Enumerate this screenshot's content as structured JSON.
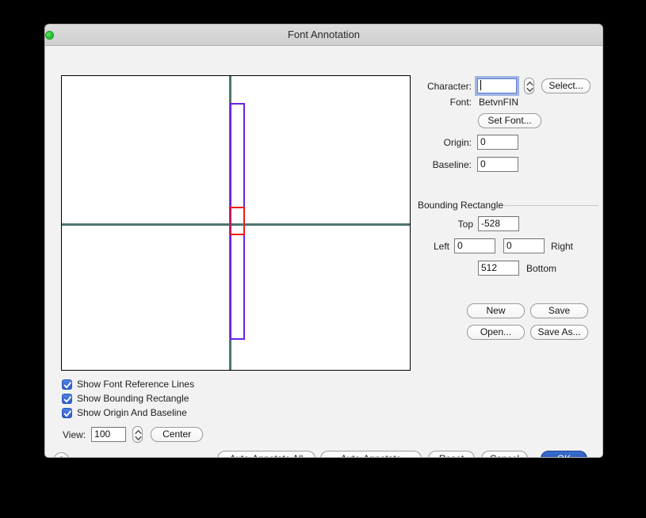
{
  "window": {
    "title": "Font Annotation",
    "traffic_lights": [
      {
        "name": "close-button",
        "state": "disabled"
      },
      {
        "name": "minimize-button",
        "state": "disabled"
      },
      {
        "name": "zoom-button",
        "state": "active",
        "color": "#16b82a"
      }
    ]
  },
  "panel": {
    "character_label": "Character:",
    "character_value": "",
    "select_button": "Select...",
    "font_label": "Font:",
    "font_value": "BetvnFIN",
    "set_font_button": "Set Font...",
    "origin_label": "Origin:",
    "origin_value": "0",
    "baseline_label": "Baseline:",
    "baseline_value": "0",
    "bounding_group_title": "Bounding Rectangle",
    "top_label": "Top",
    "top_value": "-528",
    "left_label": "Left",
    "left_value": "0",
    "right_label": "Right",
    "right_value": "0",
    "bottom_label": "Bottom",
    "bottom_value": "512",
    "new_button": "New",
    "save_button": "Save",
    "open_button": "Open...",
    "save_as_button": "Save As..."
  },
  "options": {
    "checkboxes": [
      {
        "label": "Show Font Reference Lines",
        "checked": true
      },
      {
        "label": "Show Bounding Rectangle",
        "checked": true
      },
      {
        "label": "Show Origin And Baseline",
        "checked": true
      }
    ],
    "view_label": "View:",
    "view_value": "100",
    "center_button": "Center"
  },
  "bottom_bar": {
    "help_button": "?",
    "auto_annotate_all_button": "Auto-Annotate All",
    "auto_annotate_button": "Auto-Annotate",
    "reset_button": "Reset",
    "cancel_button": "Cancel",
    "ok_button": "OK"
  },
  "canvas": {
    "origin_line_color": "#4d7571",
    "baseline_color": "#4d7571",
    "bounding_rect_color": "#6822e8",
    "glyph_rect_color": "#ef1b1b",
    "background": "#ffffff"
  }
}
